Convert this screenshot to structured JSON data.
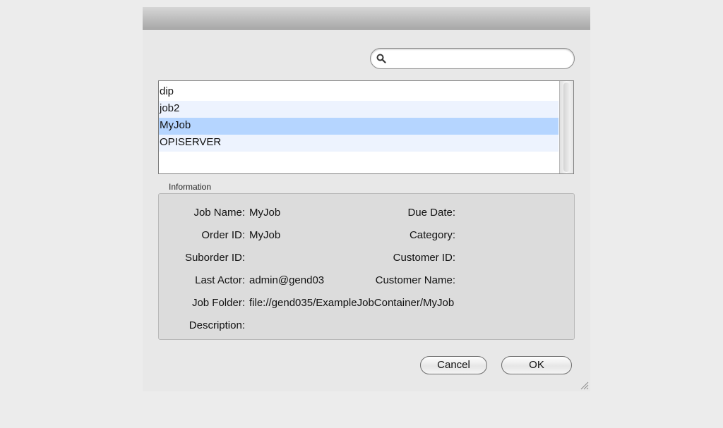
{
  "search": {
    "value": "",
    "placeholder": ""
  },
  "job_list": {
    "items": [
      "dip",
      "job2",
      "MyJob",
      "OPISERVER"
    ],
    "selected_index": 2
  },
  "information": {
    "title": "Information",
    "job_name": {
      "label": "Job Name:",
      "value": "MyJob"
    },
    "order_id": {
      "label": "Order ID:",
      "value": "MyJob"
    },
    "suborder_id": {
      "label": "Suborder ID:",
      "value": ""
    },
    "last_actor": {
      "label": "Last Actor:",
      "value": "admin@gend03"
    },
    "job_folder": {
      "label": "Job Folder:",
      "value": "file://gend035/ExampleJobContainer/MyJob"
    },
    "description": {
      "label": "Description:",
      "value": ""
    },
    "due_date": {
      "label": "Due Date:",
      "value": ""
    },
    "category": {
      "label": "Category:",
      "value": ""
    },
    "customer_id": {
      "label": "Customer ID:",
      "value": ""
    },
    "customer_name": {
      "label": "Customer Name:",
      "value": ""
    }
  },
  "buttons": {
    "cancel": "Cancel",
    "ok": "OK"
  },
  "icons": {
    "search": "search-icon",
    "resize": "resize-grip-icon"
  },
  "colors": {
    "selection": "#b5d5ff",
    "alternate_row": "#edf3fe"
  }
}
